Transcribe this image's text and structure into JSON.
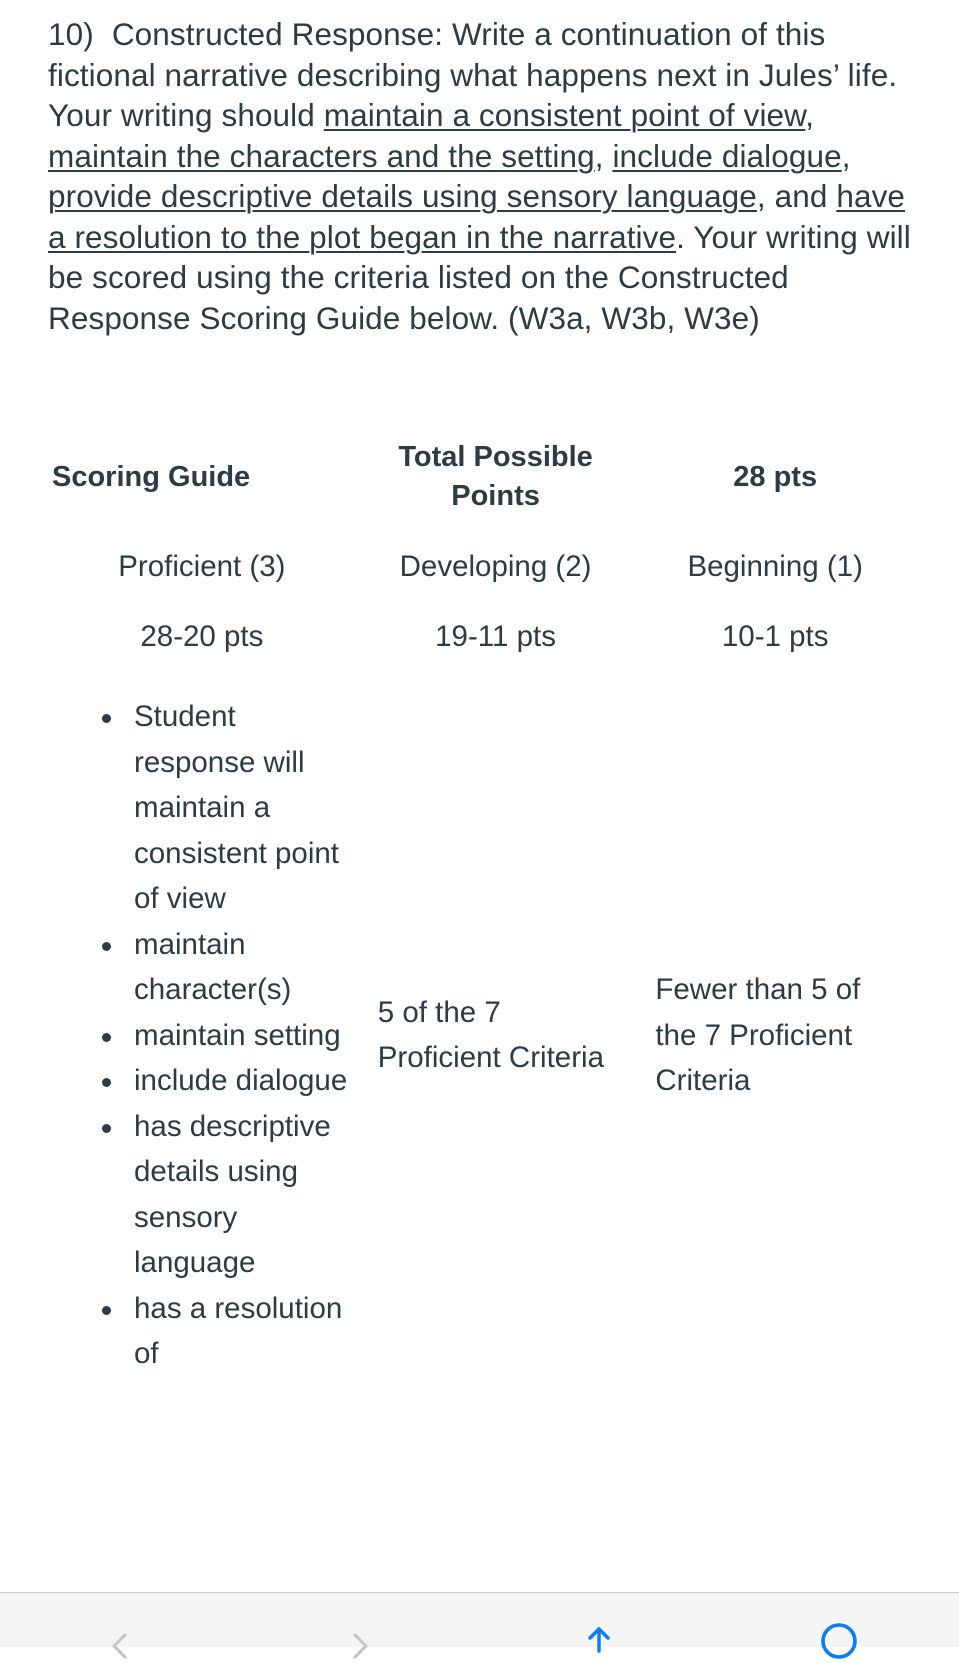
{
  "question": {
    "number": "10)",
    "segments": [
      {
        "text": "Constructed Response: Write a continuation of this fictional narrative describing what happens next in Jules’ life. Your writing should ",
        "underline": false
      },
      {
        "text": "maintain a consistent point of view",
        "underline": true
      },
      {
        "text": ", ",
        "underline": false
      },
      {
        "text": "maintain the characters and the setting",
        "underline": true
      },
      {
        "text": ", ",
        "underline": false
      },
      {
        "text": "include dialogue",
        "underline": true
      },
      {
        "text": ", ",
        "underline": false
      },
      {
        "text": "provide descriptive details using sensory language",
        "underline": true
      },
      {
        "text": ", and ",
        "underline": false
      },
      {
        "text": "have a resolution to the plot began in the narrative",
        "underline": true
      },
      {
        "text": ".  Your writing will be scored using the criteria listed on the Constructed Response Scoring Guide below.   (W3a, W3b, W3e)",
        "underline": false
      }
    ]
  },
  "scoring_guide": {
    "header": {
      "title": "Scoring Guide",
      "total_points_label": "Total Possible Points",
      "total_points_value": "28 pts"
    },
    "levels": {
      "proficient": "Proficient (3)",
      "developing": "Developing (2)",
      "beginning": "Beginning (1)"
    },
    "point_ranges": {
      "proficient": "28-20 pts",
      "developing": "19-11 pts",
      "beginning": "10-1 pts"
    },
    "proficient_criteria": [
      "Student response will maintain a consistent point of view",
      "maintain character(s)",
      "maintain setting",
      "include dialogue",
      "has descriptive details using sensory language",
      "has a resolution of"
    ],
    "developing_text": "5 of the 7 Proficient Criteria",
    "beginning_text": "Fewer than 5 of the 7 Proficient Criteria"
  },
  "bottom_toolbar": {
    "items": [
      {
        "name": "back-chevron-icon",
        "glyph": "chevron-left",
        "color": "#c7c7cc"
      },
      {
        "name": "forward-chevron-icon",
        "glyph": "chevron-right",
        "color": "#c7c7cc"
      },
      {
        "name": "share-icon",
        "glyph": "share-up-arrow",
        "color": "#0a7cf7"
      },
      {
        "name": "tabs-icon",
        "glyph": "circle-outline",
        "color": "#0a7cf7"
      }
    ]
  },
  "colors": {
    "text": "#2d3b45",
    "accent_blue": "#0a7cf7",
    "toolbar_bg": "#f5f5f5",
    "toolbar_border": "#c9c9c9",
    "inactive_icon": "#c7c7cc"
  }
}
